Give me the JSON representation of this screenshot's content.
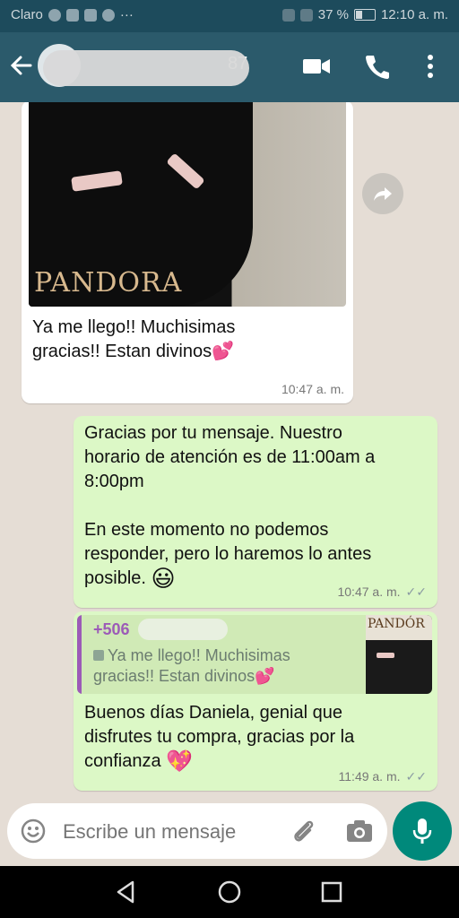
{
  "status_bar": {
    "carrier": "Claro",
    "battery": "37 %",
    "time": "12:10 a. m.",
    "dots": "···"
  },
  "header": {
    "contact_visible_suffix": "87"
  },
  "messages": [
    {
      "direction": "incoming",
      "has_image": true,
      "image_brand_text": "PANDORA",
      "text_line1": "Ya me llego!! Muchisimas",
      "text_line2": "gracias!! Estan divinos",
      "emoji": "💕",
      "time": "10:47 a. m."
    },
    {
      "direction": "outgoing",
      "lines": [
        "Gracias por tu mensaje. Nuestro",
        "horario de atención es de 11:00am a",
        "8:00pm",
        "",
        "En este momento no podemos",
        "responder, pero lo haremos lo antes",
        "posible."
      ],
      "emoji": "😃",
      "time": "10:47 a. m.",
      "ticks": "✓✓"
    },
    {
      "direction": "outgoing",
      "quote": {
        "sender_prefix": "+506",
        "line1": "Ya me llego!! Muchisimas",
        "line2": "gracias!! Estan divinos",
        "emoji": "💕",
        "thumb_brand": "PANDÓR"
      },
      "lines": [
        "Buenos días Daniela, genial que",
        "disfrutes tu compra, gracias por la",
        "confianza"
      ],
      "emoji": "💖",
      "time": "11:49 a. m.",
      "ticks": "✓✓"
    }
  ],
  "input": {
    "placeholder": "Escribe un mensaje"
  },
  "icons": {
    "back": "arrow-left-icon",
    "video": "video-call-icon",
    "call": "phone-icon",
    "menu": "more-vert-icon",
    "forward": "forward-icon",
    "emoji": "emoji-icon",
    "attach": "paperclip-icon",
    "camera": "camera-icon",
    "mic": "microphone-icon"
  },
  "colors": {
    "header": "#2b5a6b",
    "status_bar": "#1d4b5c",
    "chat_bg": "#e5ddd5",
    "outgoing": "#dcf8c6",
    "incoming": "#ffffff",
    "accent": "#00897b",
    "quote_bar": "#9c5bb7"
  }
}
